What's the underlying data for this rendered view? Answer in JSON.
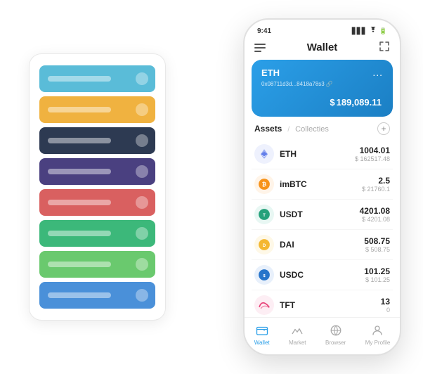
{
  "scene": {
    "background_color": "#ffffff"
  },
  "card_stack": {
    "cards": [
      {
        "color": "#5abcd8",
        "label_width": "90px"
      },
      {
        "color": "#f0b240",
        "label_width": "80px"
      },
      {
        "color": "#2d3a52",
        "label_width": "85px"
      },
      {
        "color": "#4a4080",
        "label_width": "75px"
      },
      {
        "color": "#d96060",
        "label_width": "88px"
      },
      {
        "color": "#3cb87a",
        "label_width": "70px"
      },
      {
        "color": "#6ac96e",
        "label_width": "82px"
      },
      {
        "color": "#4a90d9",
        "label_width": "78px"
      }
    ]
  },
  "phone": {
    "status_bar": {
      "time": "9:41",
      "signal": "●●●",
      "wifi": "WiFi",
      "battery": "■"
    },
    "header": {
      "menu_icon": "hamburger",
      "title": "Wallet",
      "expand_icon": "⇱"
    },
    "eth_card": {
      "title": "ETH",
      "more_icon": "...",
      "address": "0x08711d3d...8418a78s3 🔗",
      "currency_symbol": "$",
      "amount": "189,089.11"
    },
    "assets_section": {
      "tab_active": "Assets",
      "tab_divider": "/",
      "tab_inactive": "Collecties",
      "add_button": "+"
    },
    "assets": [
      {
        "icon": "eth",
        "icon_color": "#627EEA",
        "icon_bg": "#eef1fd",
        "symbol": "ETH",
        "amount": "1004.01",
        "usd": "$ 162517.48"
      },
      {
        "icon": "imbtc",
        "icon_color": "#F7931A",
        "icon_bg": "#fff4e8",
        "symbol": "imBTC",
        "amount": "2.5",
        "usd": "$ 21760.1"
      },
      {
        "icon": "usdt",
        "icon_color": "#26A17B",
        "icon_bg": "#e8f7f3",
        "symbol": "USDT",
        "amount": "4201.08",
        "usd": "$ 4201.08"
      },
      {
        "icon": "dai",
        "icon_color": "#F4B731",
        "icon_bg": "#fef8e7",
        "symbol": "DAI",
        "amount": "508.75",
        "usd": "$ 508.75"
      },
      {
        "icon": "usdc",
        "icon_color": "#2775CA",
        "icon_bg": "#e8f0fb",
        "symbol": "USDC",
        "amount": "101.25",
        "usd": "$ 101.25"
      },
      {
        "icon": "tft",
        "icon_color": "#e8447a",
        "icon_bg": "#fdeef4",
        "symbol": "TFT",
        "amount": "13",
        "usd": "0"
      }
    ],
    "bottom_nav": [
      {
        "icon": "wallet",
        "label": "Wallet",
        "active": true
      },
      {
        "icon": "market",
        "label": "Market",
        "active": false
      },
      {
        "icon": "browser",
        "label": "Browser",
        "active": false
      },
      {
        "icon": "profile",
        "label": "My Profile",
        "active": false
      }
    ]
  }
}
